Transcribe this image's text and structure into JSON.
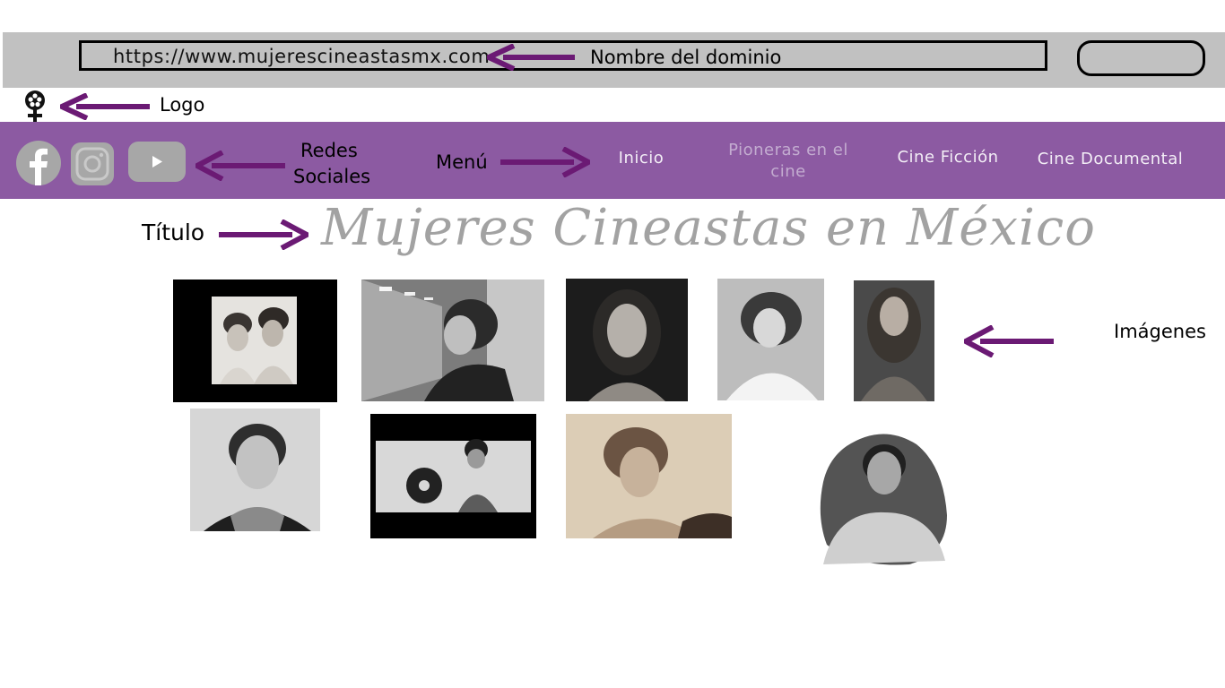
{
  "browser": {
    "url": "https://www.mujerescineastasmx.com",
    "domain_annotation": "Nombre del dominio"
  },
  "logo": {
    "annotation": "Logo",
    "icon": "female-film-reel-icon"
  },
  "social": {
    "annotation_line1": "Redes",
    "annotation_line2": "Sociales",
    "icons": [
      "facebook-icon",
      "instagram-icon",
      "youtube-icon"
    ]
  },
  "menu": {
    "annotation": "Menú",
    "items": [
      {
        "label": "Inicio"
      },
      {
        "label_line1": "Pioneras en el",
        "label_line2": "cine"
      },
      {
        "label": "Cine Ficción"
      },
      {
        "label": "Cine Documental"
      }
    ]
  },
  "title": {
    "annotation": "Título",
    "text": "Mujeres  Cineastas en México"
  },
  "images": {
    "annotation": "Imágenes"
  },
  "colors": {
    "nav_purple": "#8c5aa2",
    "arrow_purple": "#6b1a74",
    "browser_gray": "#c1c1c1",
    "title_gray": "#a2a2a2"
  }
}
